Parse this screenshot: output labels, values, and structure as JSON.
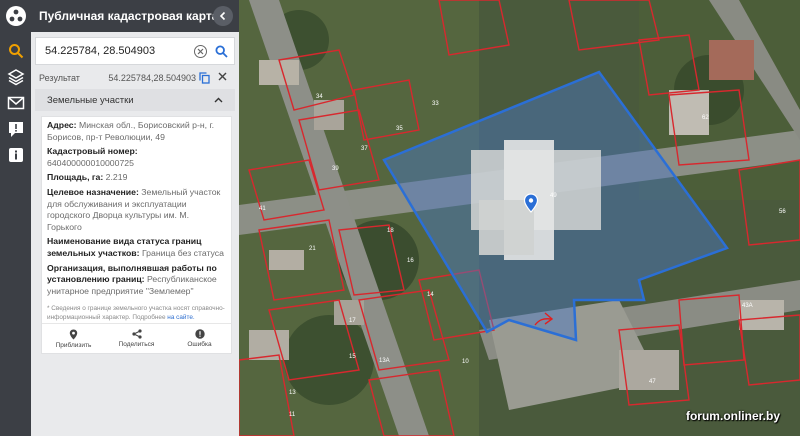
{
  "app": {
    "title": "Публичная кадастровая карта"
  },
  "rail": {
    "items": [
      {
        "icon": "search-icon"
      },
      {
        "icon": "layers-icon"
      },
      {
        "icon": "mail-check-icon"
      },
      {
        "icon": "feedback-icon"
      },
      {
        "icon": "info-icon"
      }
    ],
    "accent": "#f0a000"
  },
  "search": {
    "value": "54.225784, 28.504903"
  },
  "result": {
    "label": "Результат",
    "coords": "54.225784,28.504903"
  },
  "section": {
    "title": "Земельные участки"
  },
  "parcel": {
    "address_label": "Адрес:",
    "address_value": "Минская обл., Борисовский р-н, г. Борисов, пр-т Революции, 49",
    "cadastral_label": "Кадастровый номер:",
    "cadastral_value": "640400000010000725",
    "area_label": "Площадь, га:",
    "area_value": "2.219",
    "purpose_label": "Целевое назначение:",
    "purpose_value": "Земельный участок для обслуживания и эксплуатации городского Дворца культуры им. М. Горького",
    "status_label": "Наименование вида статуса границ земельных участков:",
    "status_value": "Граница без статуса",
    "org_label": "Организация, выполнявшая работы по установлению границ:",
    "org_value": "Республиканское унитарное предприятие \"Землемер\"",
    "note": "* Сведения о границе земельного участка носят справочно-информационный характер. Подробнее",
    "note_link": "на сайте."
  },
  "actions": {
    "approximate": "Приблизить",
    "share": "Поделиться",
    "error": "Ошибка"
  },
  "map": {
    "parcel_numbers": [
      "34",
      "33",
      "35",
      "37",
      "39",
      "41",
      "21",
      "18",
      "16",
      "14",
      "17",
      "15",
      "13",
      "11",
      "13А",
      "10",
      "49",
      "62",
      "56",
      "43А",
      "47"
    ],
    "watermark": "forum.onliner.by",
    "highlight_color": "#2b6fd6",
    "boundary_color": "#d8282e"
  }
}
